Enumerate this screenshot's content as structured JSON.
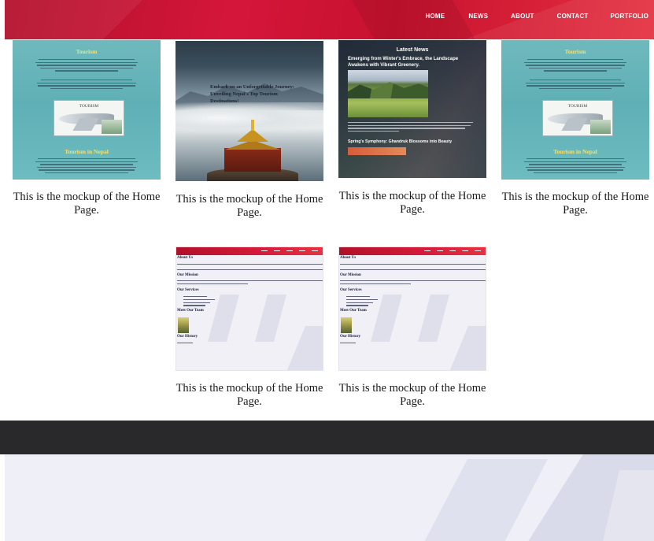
{
  "nav": {
    "links": [
      "HOME",
      "NEWS",
      "ABOUT",
      "CONTACT",
      "PORTFOLIO"
    ]
  },
  "gallery": {
    "captions": [
      "This is the mockup of the Home Page.",
      "This is the mockup of the Home Page.",
      "This is the mockup of the Home Page.",
      "This is the mockup of the Home Page.",
      "This is the mockup of the Home Page.",
      "This is the mockup of the Home Page."
    ]
  },
  "thumb_tourism": {
    "title": "Tourism",
    "box_label": "TOURISM",
    "subtitle": "Tourism in Nepal"
  },
  "thumb_mountain": {
    "text": "Embark on an Unforgettable Journey: Unveiling Nepal's Top Tourism Destinations!"
  },
  "thumb_news": {
    "title": "Latest News",
    "headline": "Emerging from Winter's Embrace, the Landscape Awakens with Vibrant Greenery.",
    "subheadline": "Spring's Symphony: Ghandruk Blossoms into Beauty"
  },
  "thumb_about": {
    "heading_about": "About Us",
    "heading_mission": "Our Mission",
    "heading_services": "Our Services",
    "heading_team": "Meet Our Team",
    "heading_history": "Our History"
  },
  "colors": {
    "nav_red": "#d4163a",
    "dark_band": "#29292c",
    "accent_yellow": "#f7e26b"
  }
}
